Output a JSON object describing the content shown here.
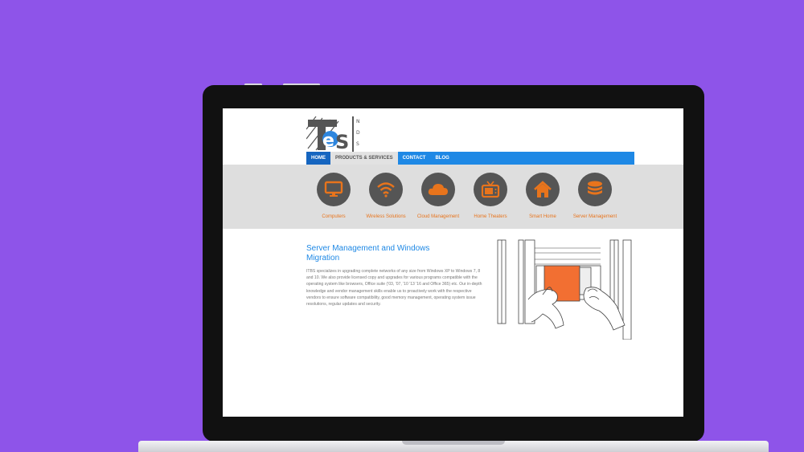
{
  "logo": {
    "text": "TeS",
    "side": "NDS"
  },
  "nav": {
    "items": [
      {
        "label": "HOME"
      },
      {
        "label": "PRODUCTS & SERVICES"
      },
      {
        "label": "CONTACT"
      },
      {
        "label": "BLOG"
      }
    ]
  },
  "services": [
    {
      "label": "Computers",
      "icon": "monitor-icon"
    },
    {
      "label": "Wireless Solutions",
      "icon": "wifi-icon"
    },
    {
      "label": "Cloud Management",
      "icon": "cloud-icon"
    },
    {
      "label": "Home Theaters",
      "icon": "tv-icon"
    },
    {
      "label": "Smart Home",
      "icon": "home-icon"
    },
    {
      "label": "Server Management",
      "icon": "database-icon"
    }
  ],
  "content": {
    "title": "Server Management and Windows Migration",
    "body": "ITBS specializes in upgrading complete networks of any size from Windows XP to Windows 7, 8 and 10. We also provide licensed copy and upgrades for various programs compatible with the operating system like browsers, Office suite ('03, '07, '10 '13 '16 and Office 365) etc. Our in-depth knowledge and vendor management skills enable us to proactively work with the respective vendors to ensure software compatibility, good memory management, operating system issue resolutions, regular updates and security."
  },
  "colors": {
    "background": "#8e54e9",
    "nav_blue": "#1e88e5",
    "accent_orange": "#e8741c",
    "icon_circle": "#555555",
    "services_band": "#dedede"
  }
}
